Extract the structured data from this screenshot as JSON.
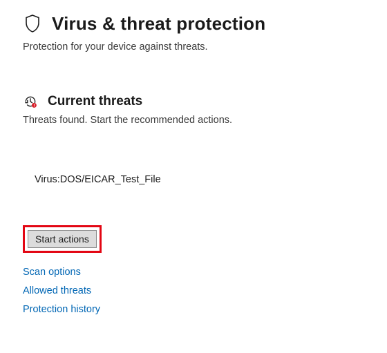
{
  "header": {
    "icon": "shield-icon",
    "title": "Virus & threat protection",
    "subtitle": "Protection for your device against threats."
  },
  "current_threats": {
    "icon": "history-alert-icon",
    "title": "Current threats",
    "subtitle": "Threats found. Start the recommended actions.",
    "items": [
      {
        "name": "Virus:DOS/EICAR_Test_File"
      }
    ],
    "start_button_label": "Start actions"
  },
  "links": {
    "scan_options": "Scan options",
    "allowed_threats": "Allowed threats",
    "protection_history": "Protection history"
  },
  "colors": {
    "highlight_border": "#e30613",
    "link": "#0066b4"
  }
}
